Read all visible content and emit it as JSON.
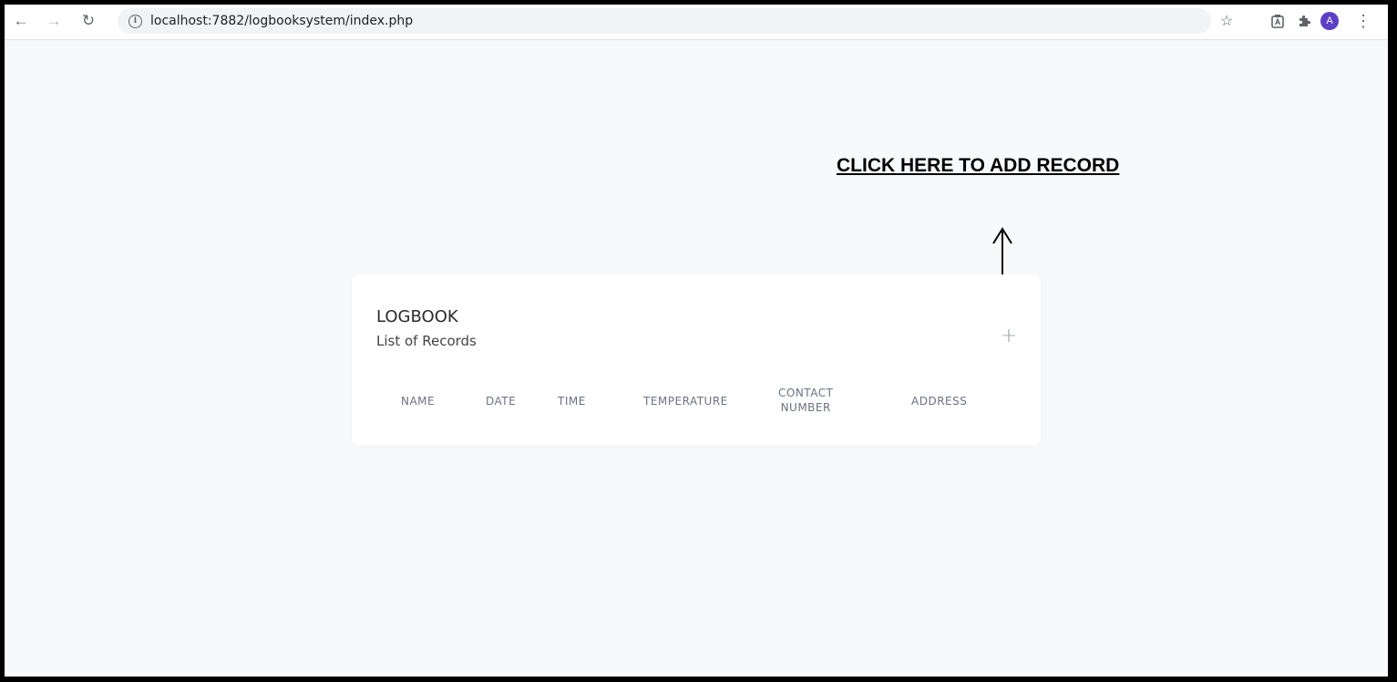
{
  "browser": {
    "url": "localhost:7882/logbooksystem/index.php",
    "avatar_letter": "A",
    "icons": [
      "back-arrow-icon",
      "forward-arrow-icon",
      "reload-icon",
      "info-icon",
      "star-icon",
      "extension-icon",
      "puzzle-icon",
      "kebab-menu-icon"
    ]
  },
  "annotation": {
    "cta_text": "CLICK HERE TO ADD RECORD"
  },
  "card": {
    "title": "LOGBOOK",
    "subtitle": "List of Records",
    "add_symbol": "+",
    "columns": [
      "NAME",
      "DATE",
      "TIME",
      "TEMPERATURE",
      "CONTACT NUMBER",
      "ADDRESS"
    ],
    "contact_line1": "CONTACT",
    "contact_line2": "NUMBER"
  }
}
